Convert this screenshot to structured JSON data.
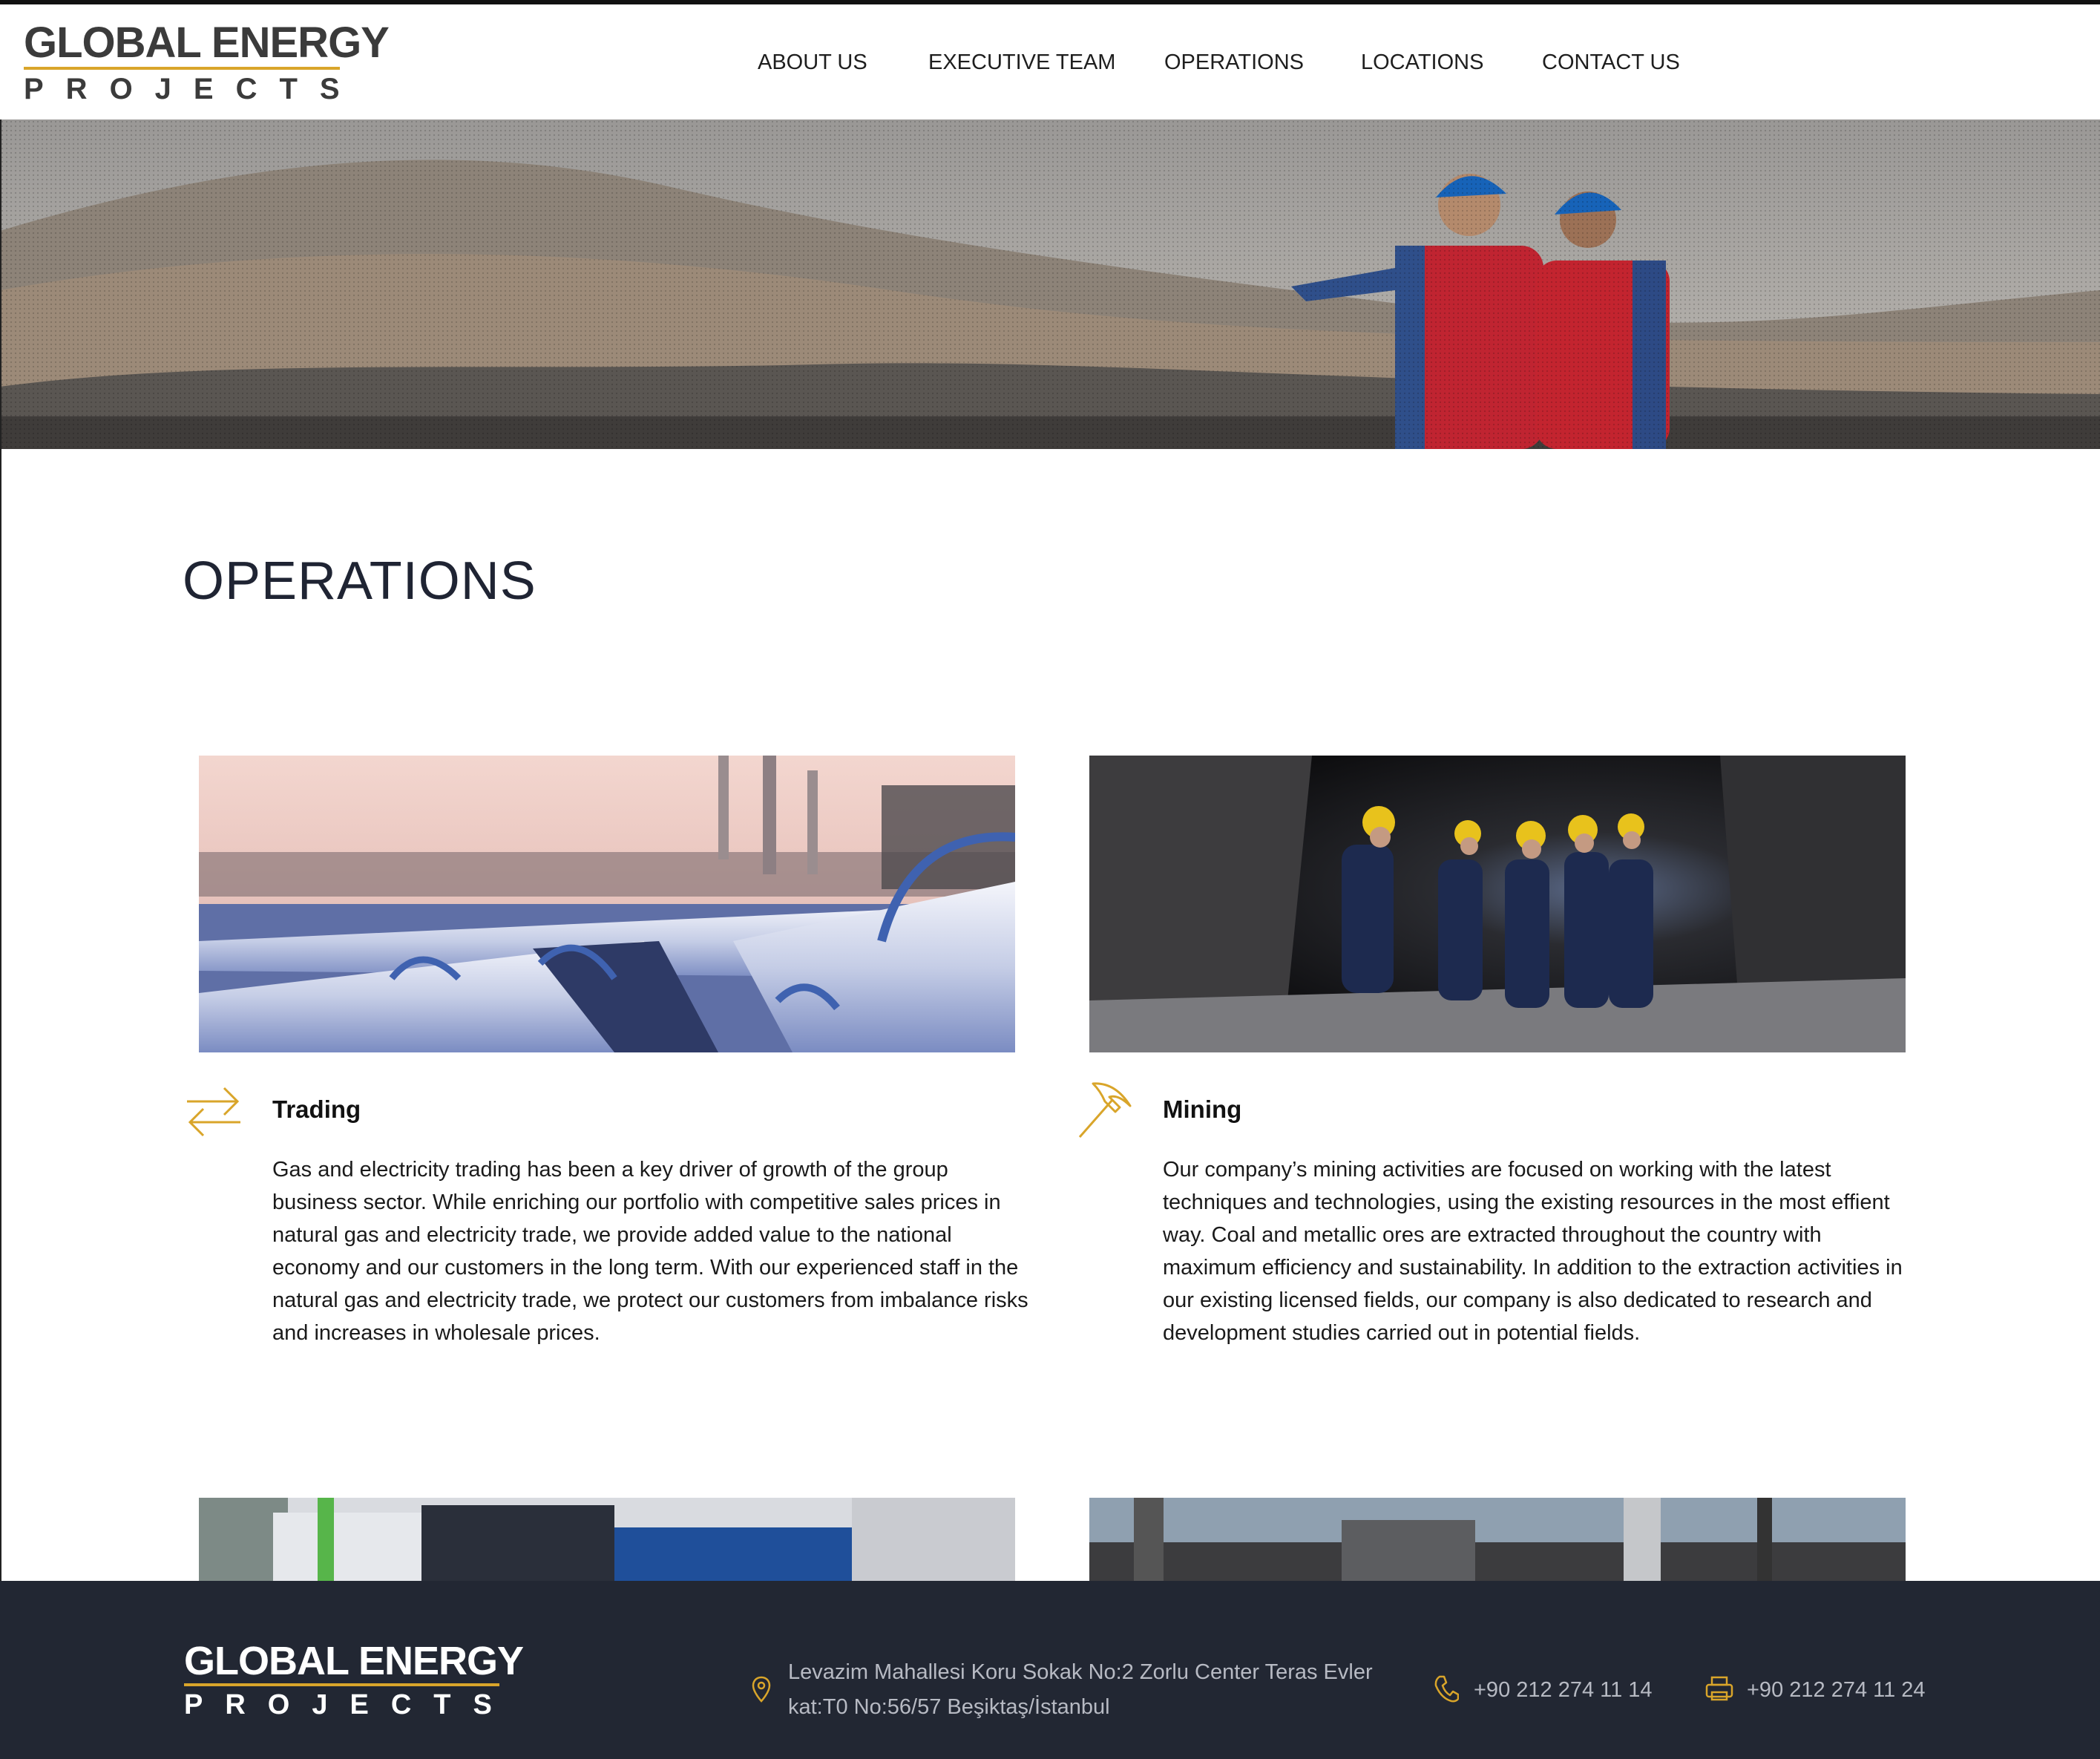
{
  "brand": {
    "line1": "GLOBAL ENERGY",
    "line2": "PROJECTS",
    "accent_color": "#d9a52a"
  },
  "nav": {
    "items": [
      {
        "label": "ABOUT US"
      },
      {
        "label": "EXECUTIVE TEAM"
      },
      {
        "label": "OPERATIONS"
      },
      {
        "label": "LOCATIONS"
      },
      {
        "label": "CONTACT US"
      }
    ]
  },
  "page": {
    "title": "OPERATIONS"
  },
  "operations": [
    {
      "title": "Trading",
      "icon": "arrows-exchange-icon",
      "text": "Gas and electricity trading has been a key driver of growth of the group business sector. While enriching our portfolio with competitive sales prices in natural gas and electricity trade, we provide added value to the national economy and our customers in the long term. With our experienced staff in the natural gas and electricity trade, we protect our customers from imbalance risks and increases in wholesale prices."
    },
    {
      "title": "Mining",
      "icon": "pickaxe-icon",
      "text": "Our company’s mining activities are focused on working with the latest techniques and technologies, using the existing resources in the most effient way. Coal and metallic ores are extracted throughout the country with maximum efficiency and sustainability. In addition to the extraction activities in our existing licensed fields, our company is also dedicated to research and development studies carried out in potential fields."
    }
  ],
  "footer": {
    "address_line1": "Levazim Mahallesi Koru Sokak No:2 Zorlu Center Teras Evler",
    "address_line2": "kat:T0 No:56/57 Beşiktaş/İstanbul",
    "phone": "+90 212 274 11 14",
    "fax": "+90 212 274 11 24",
    "background_color": "#222733"
  }
}
